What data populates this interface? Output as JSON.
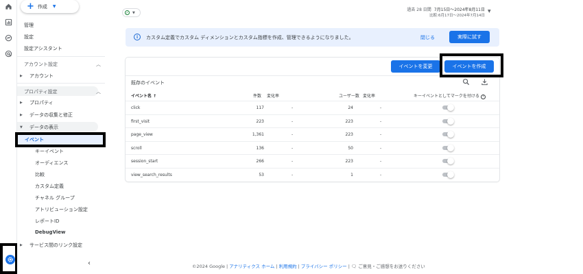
{
  "rail": {
    "icons": [
      "home-icon",
      "reports-icon",
      "explore-icon",
      "advertising-icon"
    ],
    "admin_icon": "gear-icon"
  },
  "sidebar": {
    "create_label": "作成",
    "items_top": [
      "管理",
      "設定",
      "設定アシスタント"
    ],
    "account_section": "アカウント設定",
    "account_items": [
      "アカウント"
    ],
    "property_section": "プロパティ設定",
    "property_items": [
      "プロパティ",
      "データの収集と修正",
      "データの表示"
    ],
    "display_items": [
      "イベント",
      "キーイベント",
      "オーディエンス",
      "比較",
      "カスタム定義",
      "チャネル グループ",
      "アトリビューション設定",
      "レポートID",
      "DebugView"
    ],
    "link_item": "サービス間のリンク設定"
  },
  "date_range": {
    "label": "過去 28 日間",
    "range": "7月15日～2024年8月11日",
    "compare": "比較:6月17日～2024年7月14日"
  },
  "banner": {
    "message": "カスタム定義でカスタム ディメンションとカスタム指標を作成、管理できるようになりました。",
    "close_label": "閉じる",
    "try_label": "実際に試す"
  },
  "card": {
    "modify_label": "イベントを変更",
    "create_label": "イベントを作成",
    "title": "既存のイベント",
    "columns": {
      "name": "イベント名 ↑",
      "count": "件数",
      "change1": "変化率",
      "users": "ユーザー数",
      "change2": "変化率",
      "key_event": "キーイベントとしてマークを付ける"
    },
    "rows": [
      {
        "name": "click",
        "count": "117",
        "change1": "-",
        "users": "24",
        "change2": "-",
        "key": false
      },
      {
        "name": "first_visit",
        "count": "223",
        "change1": "-",
        "users": "223",
        "change2": "-",
        "key": false
      },
      {
        "name": "page_view",
        "count": "1,361",
        "change1": "-",
        "users": "223",
        "change2": "-",
        "key": false
      },
      {
        "name": "scroll",
        "count": "136",
        "change1": "-",
        "users": "50",
        "change2": "-",
        "key": false
      },
      {
        "name": "session_start",
        "count": "266",
        "change1": "-",
        "users": "223",
        "change2": "-",
        "key": false
      },
      {
        "name": "view_search_results",
        "count": "53",
        "change1": "-",
        "users": "1",
        "change2": "-",
        "key": false
      }
    ]
  },
  "footer": {
    "copyright": "©2024 Google",
    "links": [
      "アナリティクス ホーム",
      "利用規約",
      "プライバシー ポリシー"
    ],
    "feedback": "ご意見・ご感想をお送りください"
  },
  "colors": {
    "accent": "#1a73e8",
    "banner_bg": "#e8f0fe",
    "active_bg": "#e8f0fe"
  }
}
